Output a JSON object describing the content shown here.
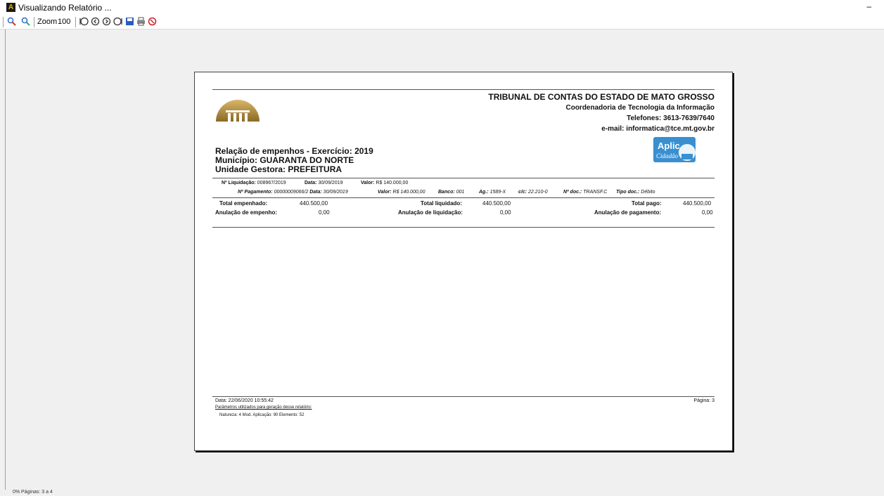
{
  "window": {
    "title": "Visualizando Relatório ...",
    "minimize": "–"
  },
  "toolbar": {
    "zoom_label": "Zoom",
    "zoom_value": "100"
  },
  "report": {
    "org_name": "TRIBUNAL DE CONTAS DO ESTADO DE MATO GROSSO",
    "org_dept": "Coordenadoria de Tecnologia da Informação",
    "org_phone": "Telefones: 3613-7639/7640",
    "org_email": "e-mail: informatica@tce.mt.gov.br",
    "aplic_label": "Aplic",
    "aplic_sub": "Cidadão",
    "title": "Relação de empenhos - Exercício: 2019",
    "municipio": "Município:  GUARANTA DO NORTE",
    "unidade": "Unidade Gestora:  PREFEITURA",
    "liq_label": "Nº Liquidação:",
    "liq_value": "008967/2019",
    "data_label": "Data:",
    "data_value": "30/09/2019",
    "valor_label": "Valor:",
    "valor_value": "R$ 140.000,00",
    "pag_label": "Nº Pagamento:",
    "pag_value": "00000009066/2",
    "pag_data_label": "Data:",
    "pag_data_value": "30/09/2019",
    "pag_valor_label": "Valor:",
    "pag_valor_value": "R$ 140.000,00",
    "banco_label": "Banco:",
    "banco_value": "001",
    "ag_label": "Ag.:",
    "ag_value": "1589-X",
    "cc_label": "c/c:",
    "cc_value": "22.210-0",
    "ndoc_label": "Nº doc.:",
    "ndoc_value": "TRANSF.C",
    "tipodoc_label": "Tipo doc.:",
    "tipodoc_value": "Débito",
    "totals": {
      "empenhado_label": "Total empenhado:",
      "empenhado_value": "440.500,00",
      "liquidado_label": "Total liquidado:",
      "liquidado_value": "440.500,00",
      "pago_label": "Total pago:",
      "pago_value": "440.500,00",
      "anul_emp_label": "Anulação de empenho:",
      "anul_emp_value": "0,00",
      "anul_liq_label": "Anulação de liquidação:",
      "anul_liq_value": "0,00",
      "anul_pag_label": "Anulação de pagamento:",
      "anul_pag_value": "0,00"
    },
    "footer_date": "Data: 22/06/2020 10:55:42",
    "footer_page": "Página: 3",
    "footer_params": "Parâmetros utilizados para geração desse relatório:",
    "footer_filters": "Natureza: 4  Mod. Aplicação: 90  Elemento: 52"
  },
  "status": {
    "text": "0% Páginas: 3 a 4"
  }
}
